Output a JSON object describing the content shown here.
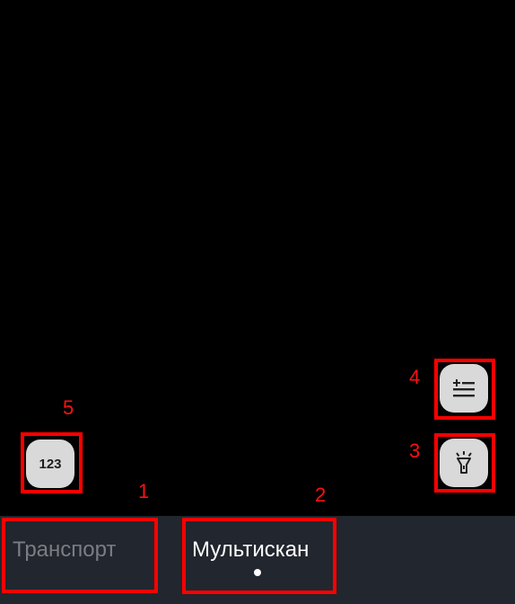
{
  "scanner": {
    "keypad_label": "123",
    "add_list_icon": "playlist-add-icon",
    "flashlight_icon": "flashlight-icon"
  },
  "tabs": [
    {
      "label": "Транспорт",
      "active": false
    },
    {
      "label": "Мультискан",
      "active": true
    }
  ],
  "annotations": {
    "marker_1": "1",
    "marker_2": "2",
    "marker_3": "3",
    "marker_4": "4",
    "marker_5": "5"
  },
  "colors": {
    "highlight": "#ff0000",
    "bottom_bar": "#22262e",
    "button_bg": "#d9d9d9",
    "active_tab": "#ffffff",
    "inactive_tab": "#7a7d84"
  }
}
